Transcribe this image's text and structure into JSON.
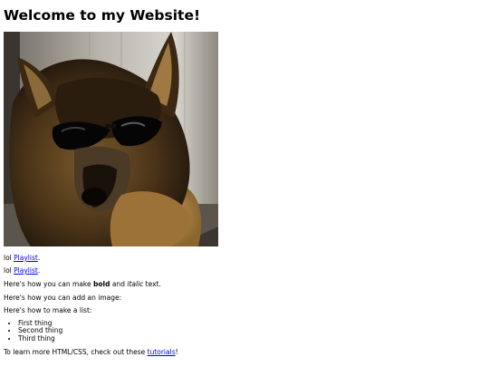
{
  "page": {
    "heading": "Welcome to my Website!",
    "image_alt": "German shepherd dog wearing sunglasses",
    "para1": {
      "prefix": "lol ",
      "link": "Playlist",
      "suffix": "."
    },
    "para2": {
      "prefix": "lol ",
      "link": "Playlist",
      "suffix": "."
    },
    "para3": {
      "prefix": "Here's how you can make ",
      "bold": "bold",
      "middle": " and ",
      "italic": "italic",
      "suffix": " text."
    },
    "para4": "Here's how you can add an image:",
    "para5": "Here's how to make a list:",
    "list": [
      "First thing",
      "Second thing",
      "Third thing"
    ],
    "para6": {
      "prefix": "To learn more HTML/CSS, check out these ",
      "link": "tutorials",
      "suffix": "!"
    }
  },
  "colors": {
    "link": "#0000ee",
    "text": "#000000",
    "background": "#ffffff"
  }
}
